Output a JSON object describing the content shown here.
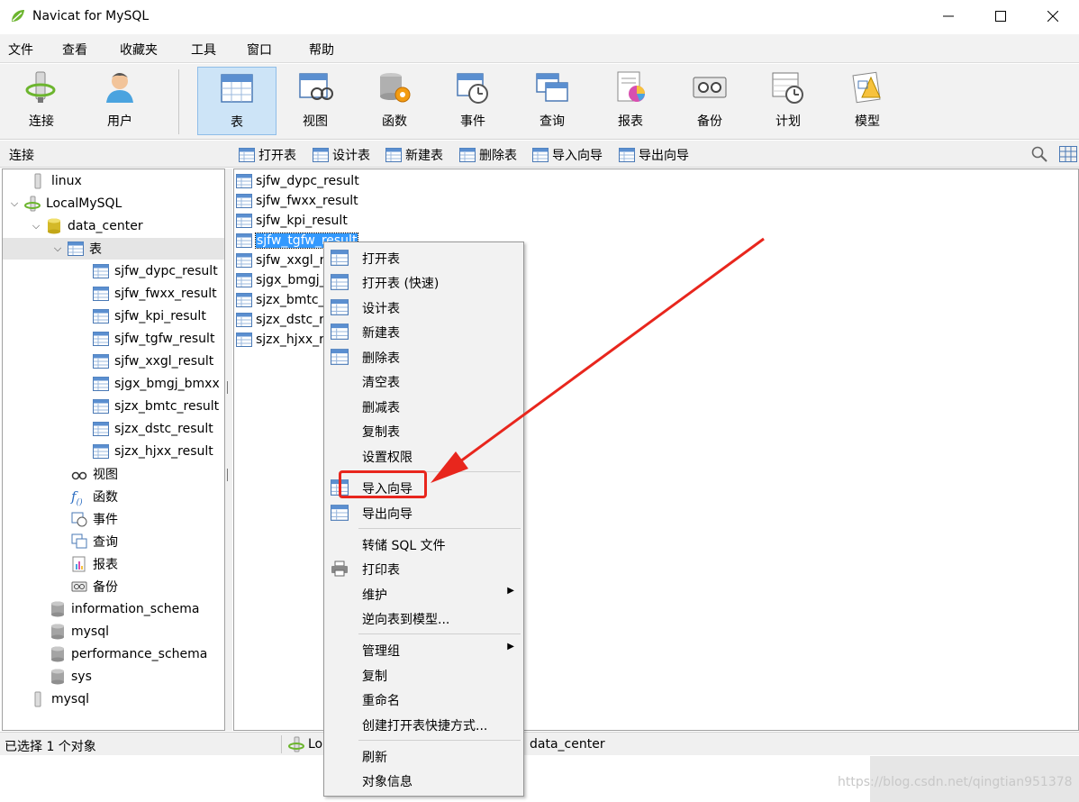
{
  "window": {
    "title": "Navicat for MySQL"
  },
  "menu": [
    "文件",
    "查看",
    "收藏夹",
    "工具",
    "窗口",
    "帮助"
  ],
  "toolbar": [
    {
      "label": "连接",
      "icon": "connection-icon"
    },
    {
      "label": "用户",
      "icon": "user-icon"
    },
    {
      "label": "表",
      "icon": "table-icon",
      "active": true
    },
    {
      "label": "视图",
      "icon": "view-icon"
    },
    {
      "label": "函数",
      "icon": "function-icon"
    },
    {
      "label": "事件",
      "icon": "event-icon"
    },
    {
      "label": "查询",
      "icon": "query-icon"
    },
    {
      "label": "报表",
      "icon": "report-icon"
    },
    {
      "label": "备份",
      "icon": "backup-icon"
    },
    {
      "label": "计划",
      "icon": "schedule-icon"
    },
    {
      "label": "模型",
      "icon": "model-icon"
    }
  ],
  "subbar": {
    "connections_title": "连接",
    "actions": [
      "打开表",
      "设计表",
      "新建表",
      "删除表",
      "导入向导",
      "导出向导"
    ]
  },
  "tree": {
    "connection1": "linux",
    "connection2": "LocalMySQL",
    "database": "data_center",
    "tables_group": "表",
    "tables": [
      "sjfw_dypc_result",
      "sjfw_fwxx_result",
      "sjfw_kpi_result",
      "sjfw_tgfw_result",
      "sjfw_xxgl_result",
      "sjgx_bmgj_bmxx",
      "sjzx_bmtc_result",
      "sjzx_dstc_result",
      "sjzx_hjxx_result"
    ],
    "other_groups": [
      "视图",
      "函数",
      "事件",
      "查询",
      "报表",
      "备份"
    ],
    "other_dbs": [
      "information_schema",
      "mysql",
      "performance_schema",
      "sys"
    ],
    "connection3": "mysql"
  },
  "objects": [
    "sjfw_dypc_result",
    "sjfw_fwxx_result",
    "sjfw_kpi_result",
    "sjfw_tgfw_result",
    "sjfw_xxgl_r",
    "sjgx_bmgj_",
    "sjzx_bmtc_",
    "sjzx_dstc_r",
    "sjzx_hjxx_re"
  ],
  "selected_object": "sjfw_tgfw_result",
  "context_menu": {
    "items": [
      "打开表",
      "打开表 (快速)",
      "设计表",
      "新建表",
      "删除表",
      "清空表",
      "删减表",
      "复制表",
      "设置权限",
      "导入向导",
      "导出向导",
      "转储 SQL 文件",
      "打印表",
      "维护",
      "逆向表到模型...",
      "管理组",
      "复制",
      "重命名",
      "创建打开表快捷方式...",
      "刷新",
      "对象信息"
    ],
    "highlighted": "导入向导"
  },
  "status": {
    "selection": "已选择 1 个对象",
    "connection": "Lo",
    "database": "data_center"
  },
  "watermark": "https://blog.csdn.net/qingtian951378",
  "colors": {
    "highlight_red": "#e8261d",
    "selection_blue": "#3399ff",
    "active_tool": "#cde4f7"
  }
}
